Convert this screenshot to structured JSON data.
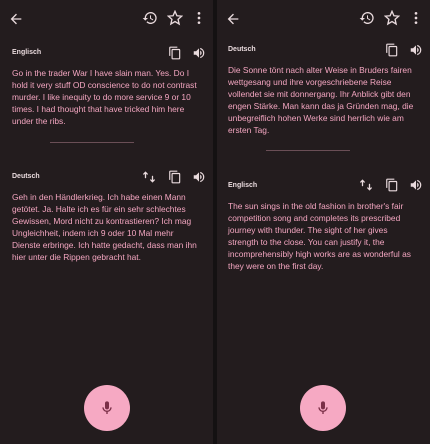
{
  "colors": {
    "background": "#231c1e",
    "accent_text": "#f4a6c1",
    "label": "#e9dadd",
    "mic_button": "#f6a9c3",
    "mic_icon": "#7a2f47"
  },
  "left": {
    "source": {
      "language": "Englisch",
      "text": "Go in the trader War I have slain man. Yes. Do I hold it very stuff OD conscience to do not contrast murder. I like inequity to do more service 9 or 10 times. I had thought that have tricked him here under the ribs."
    },
    "target": {
      "language": "Deutsch",
      "text": "Geh in den Händlerkrieg. Ich habe einen Mann getötet. Ja. Halte ich es für ein sehr schlechtes Gewissen, Mord nicht zu kontrastieren? Ich mag Ungleichheit, indem ich 9 oder 10 Mal mehr Dienste erbringe. Ich hatte gedacht, dass man ihn hier unter die Rippen gebracht hat."
    }
  },
  "right": {
    "source": {
      "language": "Deutsch",
      "text": "Die Sonne tönt nach alter Weise in Bruders fairen wettgesang und ihre vorgeschriebene Reise vollendet sie mit donnergang. Ihr Anblick gibt den engen Stärke. Man kann das ja Gründen mag, die unbegreiflich hohen Werke sind herrlich wie am ersten Tag."
    },
    "target": {
      "language": "Englisch",
      "text": "The sun sings in the old fashion in brother's fair competition song and completes its prescribed journey with thunder.  The sight of her gives strength to the close.  You can justify it, the incomprehensibly high works are as wonderful as they were on the first day."
    }
  },
  "icons": {
    "back": "arrow-back-icon",
    "history": "history-icon",
    "star": "star-icon",
    "more": "more-vert-icon",
    "copy": "copy-icon",
    "speaker": "speaker-icon",
    "swap": "swap-icon",
    "mic": "mic-icon"
  }
}
